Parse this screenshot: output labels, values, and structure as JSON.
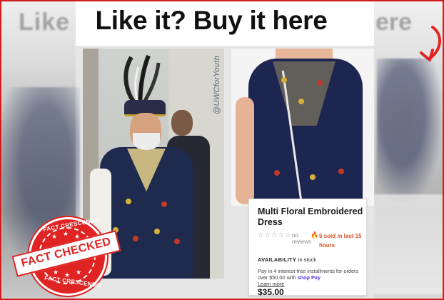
{
  "header": {
    "headline": "Like it? Buy it here"
  },
  "left_photo": {
    "watermark": "@UWCforYouth"
  },
  "background": {
    "ghost_left": "Like",
    "ghost_right": "ere"
  },
  "product": {
    "title": "Multi Floral Embroidered Dress",
    "stars": "☆☆☆☆☆",
    "reviews_label": "no reviews",
    "sold_label": "5 sold in last 15 hours",
    "availability_label": "AVAILABILITY",
    "availability_value": "In stock",
    "installments_text": "Pay in 4 interest-free installments for orders over $50.00 with",
    "shop_badge": "shop Pay",
    "learn_more": "Learn more",
    "price": "$35.00"
  },
  "stamp": {
    "top_ring": "FACT CRESCENDO",
    "ribbon": "FACT CHECKED",
    "bottom_ring": "FACT CRESCENDO"
  },
  "colors": {
    "frame_border": "#d01c1c",
    "stamp_red": "#e02424",
    "dress_navy": "#1d2650",
    "sold_orange": "#d9542a",
    "shop_pay_purple": "#5a31f4"
  },
  "icons": [
    "arrow-icon",
    "fire-icon",
    "star-icon"
  ]
}
